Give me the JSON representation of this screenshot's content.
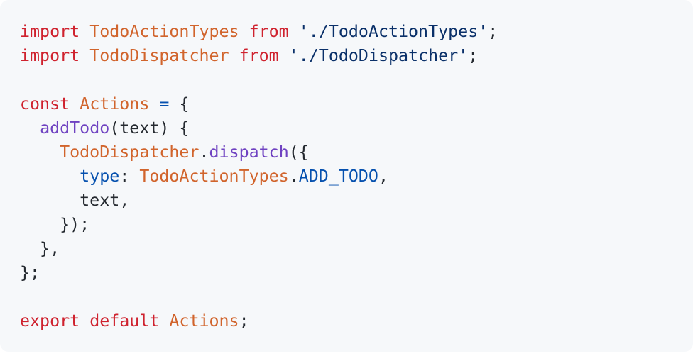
{
  "code": {
    "language": "javascript",
    "colors": {
      "background": "#f6f8fa",
      "keyword": "#cf222e",
      "identifier": "#d1642c",
      "string": "#0a3069",
      "function": "#6f42c1",
      "property": "#0550ae",
      "text": "#24292f"
    },
    "lines": [
      [
        {
          "text": "import",
          "type": "keyword"
        },
        {
          "text": " ",
          "type": "text"
        },
        {
          "text": "TodoActionTypes",
          "type": "identifier"
        },
        {
          "text": " ",
          "type": "text"
        },
        {
          "text": "from",
          "type": "keyword"
        },
        {
          "text": " ",
          "type": "text"
        },
        {
          "text": "'./TodoActionTypes'",
          "type": "string"
        },
        {
          "text": ";",
          "type": "text"
        }
      ],
      [
        {
          "text": "import",
          "type": "keyword"
        },
        {
          "text": " ",
          "type": "text"
        },
        {
          "text": "TodoDispatcher",
          "type": "identifier"
        },
        {
          "text": " ",
          "type": "text"
        },
        {
          "text": "from",
          "type": "keyword"
        },
        {
          "text": " ",
          "type": "text"
        },
        {
          "text": "'./TodoDispatcher'",
          "type": "string"
        },
        {
          "text": ";",
          "type": "text"
        }
      ],
      [],
      [
        {
          "text": "const",
          "type": "keyword"
        },
        {
          "text": " ",
          "type": "text"
        },
        {
          "text": "Actions",
          "type": "identifier"
        },
        {
          "text": " ",
          "type": "text"
        },
        {
          "text": "=",
          "type": "property"
        },
        {
          "text": " {",
          "type": "text"
        }
      ],
      [
        {
          "text": "  ",
          "type": "text"
        },
        {
          "text": "addTodo",
          "type": "function"
        },
        {
          "text": "(text) {",
          "type": "text"
        }
      ],
      [
        {
          "text": "    ",
          "type": "text"
        },
        {
          "text": "TodoDispatcher",
          "type": "identifier"
        },
        {
          "text": ".",
          "type": "text"
        },
        {
          "text": "dispatch",
          "type": "function"
        },
        {
          "text": "({",
          "type": "text"
        }
      ],
      [
        {
          "text": "      ",
          "type": "text"
        },
        {
          "text": "type",
          "type": "property"
        },
        {
          "text": ": ",
          "type": "text"
        },
        {
          "text": "TodoActionTypes",
          "type": "identifier"
        },
        {
          "text": ".",
          "type": "text"
        },
        {
          "text": "ADD_TODO",
          "type": "property"
        },
        {
          "text": ",",
          "type": "text"
        }
      ],
      [
        {
          "text": "      text,",
          "type": "text"
        }
      ],
      [
        {
          "text": "    });",
          "type": "text"
        }
      ],
      [
        {
          "text": "  },",
          "type": "text"
        }
      ],
      [
        {
          "text": "};",
          "type": "text"
        }
      ],
      [],
      [
        {
          "text": "export",
          "type": "keyword"
        },
        {
          "text": " ",
          "type": "text"
        },
        {
          "text": "default",
          "type": "keyword"
        },
        {
          "text": " ",
          "type": "text"
        },
        {
          "text": "Actions",
          "type": "identifier"
        },
        {
          "text": ";",
          "type": "text"
        }
      ]
    ]
  }
}
